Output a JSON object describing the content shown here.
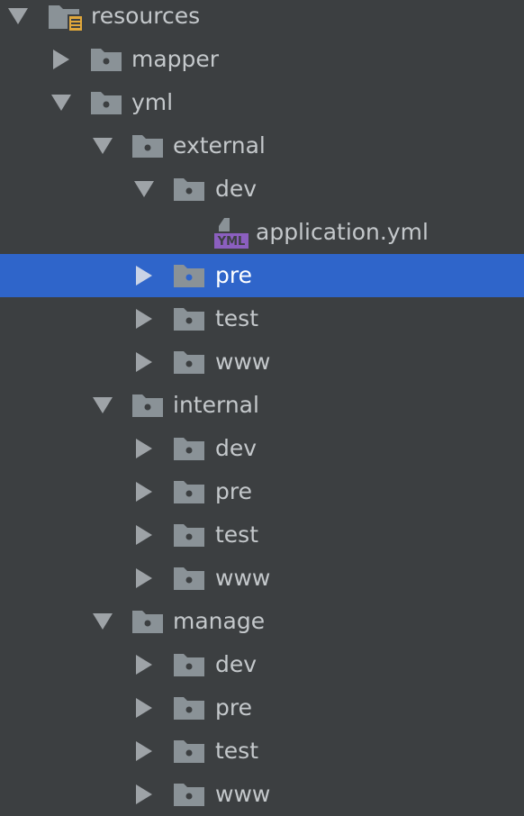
{
  "tree": {
    "resources": {
      "label": "resources",
      "expanded": true,
      "icon": "resources-folder-icon"
    },
    "mapper": {
      "label": "mapper",
      "expanded": false,
      "icon": "folder-icon"
    },
    "yml": {
      "label": "yml",
      "expanded": true,
      "icon": "folder-icon"
    },
    "external": {
      "label": "external",
      "expanded": true,
      "dev": {
        "label": "dev",
        "expanded": true
      },
      "application_yml": {
        "label": "application.yml",
        "badge": "YML",
        "icon": "yml-file-icon"
      },
      "pre": {
        "label": "pre",
        "expanded": false,
        "selected": true
      },
      "test": {
        "label": "test",
        "expanded": false
      },
      "www": {
        "label": "www",
        "expanded": false
      }
    },
    "internal": {
      "label": "internal",
      "expanded": true,
      "dev": {
        "label": "dev",
        "expanded": false
      },
      "pre": {
        "label": "pre",
        "expanded": false
      },
      "test": {
        "label": "test",
        "expanded": false
      },
      "www": {
        "label": "www",
        "expanded": false
      }
    },
    "manage": {
      "label": "manage",
      "expanded": true,
      "dev": {
        "label": "dev",
        "expanded": false
      },
      "pre": {
        "label": "pre",
        "expanded": false
      },
      "test": {
        "label": "test",
        "expanded": false
      },
      "www": {
        "label": "www",
        "expanded": false
      }
    }
  },
  "colors": {
    "background": "#3c3f41",
    "selection": "#2f65ca",
    "text": "#c4c8cb",
    "selected_text": "#ffffff",
    "folder": "#8a9297",
    "yml_badge": "#8b5fbf",
    "resources_badge": "#e0a73b"
  }
}
